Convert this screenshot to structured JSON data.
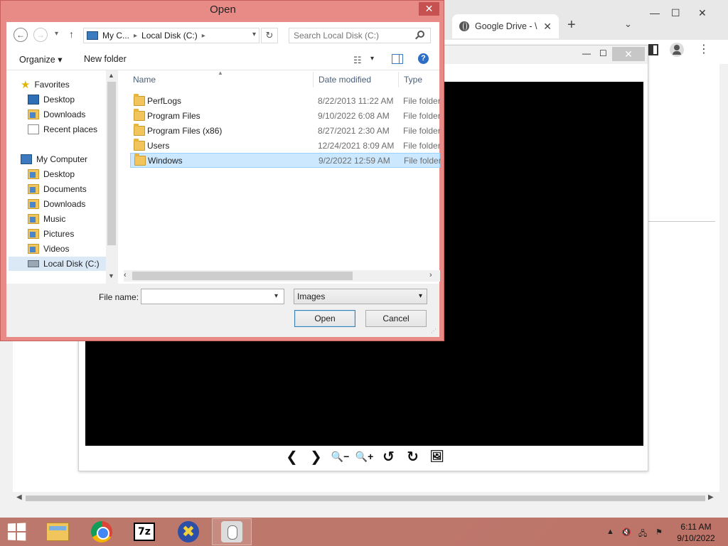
{
  "browser": {
    "tab_title": "Google Drive - \\",
    "tab_close": "✕",
    "new_tab": "+",
    "tab_dropdown": "⌄",
    "minimize": "—",
    "maximize": "☐",
    "close": "✕",
    "menu": "⋮",
    "viewer": {
      "minimize": "—",
      "maximize": "☐",
      "close": "✕",
      "toolbar": {
        "prev": "❮",
        "next": "❯",
        "zoom_out": "🔍−",
        "zoom_in": "🔍+",
        "rotate_left": "↺",
        "rotate_right": "↻",
        "gallery": "🖼"
      }
    }
  },
  "dialog": {
    "title": "Open",
    "close": "✕",
    "nav": {
      "back": "←",
      "forward": "→",
      "recent": "▾",
      "up": "↑",
      "breadcrumb": [
        "My C...",
        "Local Disk (C:)"
      ],
      "refresh": "↻",
      "search_placeholder": "Search Local Disk (C:)"
    },
    "commands": {
      "organize": "Organize ▾",
      "new_folder": "New folder",
      "view_menu": "▾",
      "help": "?"
    },
    "nav_pane": {
      "favorites": "Favorites",
      "favorites_items": [
        "Desktop",
        "Downloads",
        "Recent places"
      ],
      "computer": "My Computer",
      "computer_items": [
        "Desktop",
        "Documents",
        "Downloads",
        "Music",
        "Pictures",
        "Videos",
        "Local Disk (C:)"
      ]
    },
    "columns": {
      "name": "Name",
      "date": "Date modified",
      "type": "Type"
    },
    "files": [
      {
        "name": "PerfLogs",
        "date": "8/22/2013 11:22 AM",
        "type": "File folder"
      },
      {
        "name": "Program Files",
        "date": "9/10/2022 6:08 AM",
        "type": "File folder"
      },
      {
        "name": "Program Files (x86)",
        "date": "8/27/2021 2:30 AM",
        "type": "File folder"
      },
      {
        "name": "Users",
        "date": "12/24/2021 8:09 AM",
        "type": "File folder"
      },
      {
        "name": "Windows",
        "date": "9/2/2022 12:59 AM",
        "type": "File folder"
      }
    ],
    "selected_file": "Windows",
    "file_name_label": "File name:",
    "file_name_value": "",
    "file_type": "Images",
    "open_button": "Open",
    "cancel_button": "Cancel"
  },
  "taskbar": {
    "apps": [
      "file-explorer",
      "chrome",
      "7-zip",
      "xnview",
      "image-viewer"
    ],
    "tray_expand": "▲",
    "clock_time": "6:11 AM",
    "clock_date": "9/10/2022"
  }
}
